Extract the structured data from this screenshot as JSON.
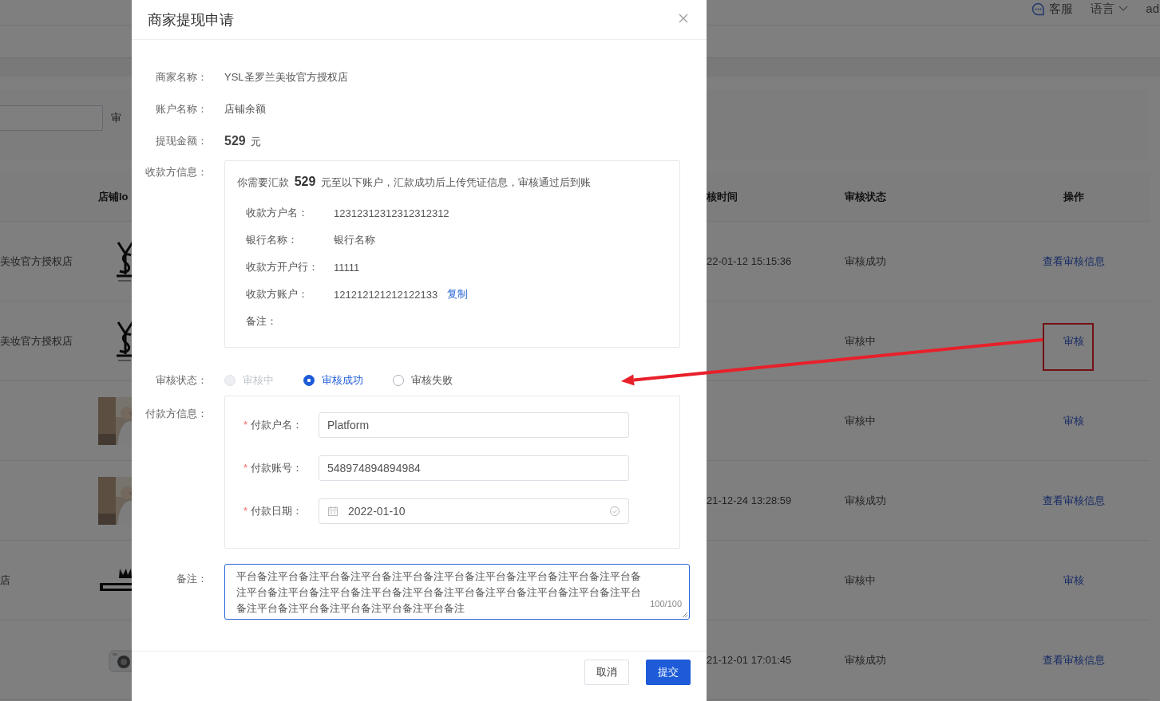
{
  "topbar": {
    "items": [
      {
        "kind": "support",
        "label": "客服"
      },
      {
        "kind": "language",
        "label": "语言"
      },
      {
        "kind": "user",
        "label": "ad"
      }
    ]
  },
  "filter": {
    "label": "审"
  },
  "table": {
    "columns": [
      {
        "label": "店铺lo",
        "kind": "logo"
      },
      {
        "label": "核时间",
        "kind": "time"
      },
      {
        "label": "审核状态",
        "kind": "status"
      },
      {
        "label": "操作",
        "kind": "action"
      }
    ],
    "rows": [
      {
        "store": "美妆官方授权店",
        "logo": {
          "kind": "monogram"
        },
        "time": "22-01-12 15:15:36",
        "status": "审核成功",
        "action": "查看审核信息",
        "highlighted": false
      },
      {
        "store": "美妆官方授权店",
        "logo": {
          "kind": "monogram"
        },
        "status": "审核中",
        "action": "审核",
        "highlighted": true
      },
      {
        "status": "审核中",
        "action": "审核",
        "highlighted": false
      },
      {
        "time": "21-12-24 13:28:59",
        "status": "审核成功",
        "action": "查看审核信息",
        "highlighted": false
      },
      {
        "store": "店",
        "logo": {
          "kind": "crown"
        },
        "status": "审核中",
        "action": "审核",
        "highlighted": false
      },
      {
        "logo": {
          "kind": "camera"
        },
        "time": "21-12-01 17:01:45",
        "status": "审核成功",
        "action": "查看审核信息",
        "highlighted": false
      }
    ]
  },
  "dialog": {
    "title": "商家提现申请",
    "fields": [
      {
        "label": "商家名称：",
        "value": "YSL圣罗兰美妆官方授权店"
      },
      {
        "label": "账户名称：",
        "value": "店铺余额"
      }
    ],
    "amount": {
      "label": "提现金额：",
      "value": "529",
      "unit": "元"
    },
    "payee": {
      "label": "收款方信息：",
      "notice": "你需要汇款 **529** 元至以下账户，汇款成功后上传凭证信息，审核通过后到账",
      "rows": [
        {
          "label": "收款方户名：",
          "value": "12312312312312312312"
        },
        {
          "label": "银行名称：",
          "value": "银行名称"
        },
        {
          "label": "收款方开户行：",
          "value": "11111"
        },
        {
          "label": "收款方账户：",
          "value": "121212121212122133",
          "link": "复制"
        },
        {
          "label": "备注："
        }
      ]
    },
    "review": {
      "label": "审核状态：",
      "options": [
        {
          "label": "审核中",
          "selected": false,
          "disabled": true
        },
        {
          "label": "审核成功",
          "selected": true,
          "disabled": false
        },
        {
          "label": "审核失败",
          "selected": false,
          "disabled": false
        }
      ]
    },
    "payer": {
      "label": "付款方信息：",
      "fields": [
        {
          "label": "付款户名：",
          "required_mark": "*",
          "kind": "text",
          "value": "Platform"
        },
        {
          "label": "付款账号：",
          "required_mark": "*",
          "kind": "text",
          "value": "548974894894984"
        },
        {
          "label": "付款日期：",
          "required_mark": "*",
          "kind": "date",
          "value": "2022-01-10"
        }
      ]
    },
    "remark": {
      "label": "备注：",
      "value": "平台备注平台备注平台备注平台备注平台备注平台备注平台备注平台备注平台备注平台备注平台备注平台备注平台备注平台备注平台备注平台备注平台备注平台备注平台备注平台备注平台备注平台备注平台备注平台备注平台备注",
      "counter": "100/100",
      "focused": true
    },
    "buttons": [
      {
        "label": "取消",
        "primary": false
      },
      {
        "label": "提交",
        "primary": true
      }
    ]
  }
}
